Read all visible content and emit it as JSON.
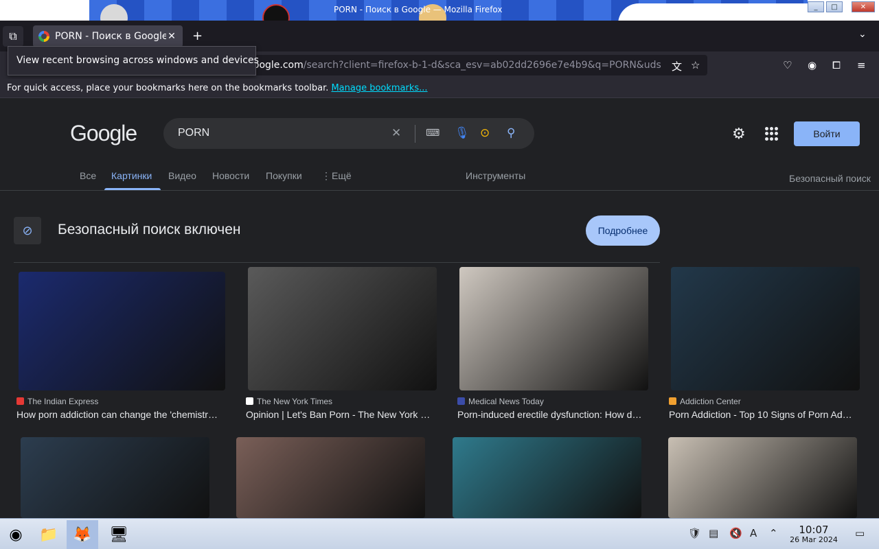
{
  "window": {
    "title": "PORN - Поиск в Google — Mozilla Firefox"
  },
  "browser": {
    "tab_label": "PORN - Поиск в Google",
    "tooltip": "View recent browsing across windows and devices",
    "url_host": "google.com",
    "url_path": "/search?client=firefox-b-1-d&sca_esv=ab02dd2696e7e4b9&q=PORN&uds",
    "bookmarks_text": "For quick access, place your bookmarks here on the bookmarks toolbar.",
    "bookmarks_link": "Manage bookmarks..."
  },
  "google": {
    "logo": "Google",
    "query": "PORN",
    "signin_label": "Войти",
    "tabs": [
      "Все",
      "Картинки",
      "Видео",
      "Новости",
      "Покупки",
      "Ещё"
    ],
    "tools": "Инструменты",
    "safe_search": "Безопасный поиск",
    "safe_banner": "Безопасный поиск включен",
    "more_label": "Подробнее"
  },
  "results": [
    {
      "source": "The Indian Express",
      "caption": "How porn addiction can change the 'chemistr…",
      "color": "#1b2a6e",
      "fav": "#e53935"
    },
    {
      "source": "The New York Times",
      "caption": "Opinion | Let's Ban Porn - The New York …",
      "color": "#5a5a5a",
      "fav": "#ffffff"
    },
    {
      "source": "Medical News Today",
      "caption": "Porn-induced erectile dysfunction: How d…",
      "color": "#cfc8c0",
      "fav": "#3b4ca8"
    },
    {
      "source": "Addiction Center",
      "caption": "Porn Addiction - Top 10 Signs of Porn Ad…",
      "color": "#22384a",
      "fav": "#f0a030"
    },
    {
      "source": "",
      "caption": "",
      "color": "#2c3d4f",
      "fav": ""
    },
    {
      "source": "",
      "caption": "",
      "color": "#7a5f58",
      "fav": ""
    },
    {
      "source": "",
      "caption": "",
      "color": "#2f7a8c",
      "fav": ""
    },
    {
      "source": "",
      "caption": "",
      "color": "#c8bfb3",
      "fav": ""
    }
  ],
  "taskbar": {
    "time": "10:07",
    "date": "26 Mar 2024"
  }
}
